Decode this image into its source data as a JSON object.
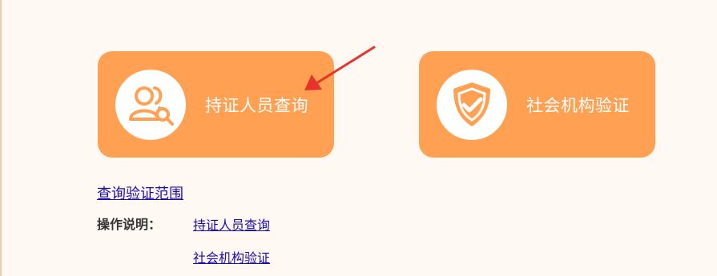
{
  "cards": [
    {
      "label": "持证人员查询",
      "icon": "person-search-icon"
    },
    {
      "label": "社会机构验证",
      "icon": "shield-check-icon"
    }
  ],
  "links": {
    "scope": "查询验证范围"
  },
  "instructions": {
    "label": "操作说明：",
    "items": [
      "持证人员查询",
      "社会机构验证"
    ]
  },
  "colors": {
    "card": "#ffa052",
    "background": "#fff8f3",
    "link": "#1a0dab",
    "arrow": "#e8332c"
  }
}
